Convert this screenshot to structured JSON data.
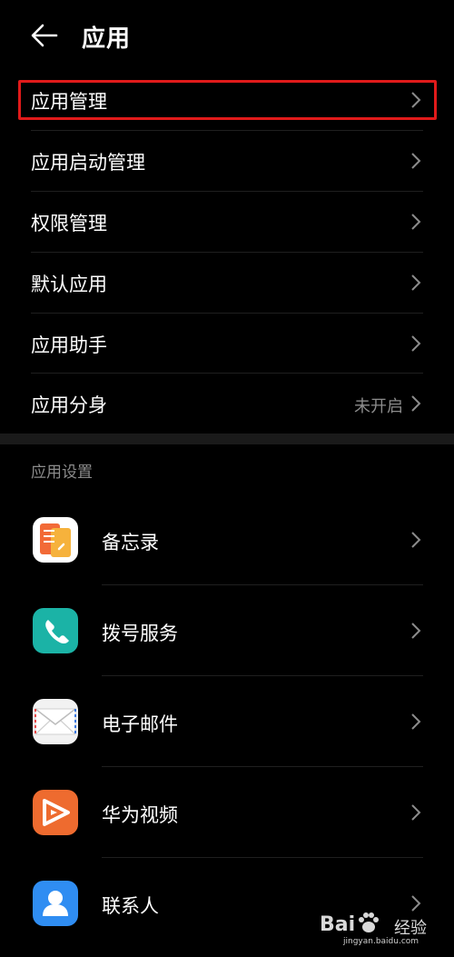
{
  "header": {
    "title": "应用"
  },
  "menu": [
    {
      "label": "应用管理",
      "value": ""
    },
    {
      "label": "应用启动管理",
      "value": ""
    },
    {
      "label": "权限管理",
      "value": ""
    },
    {
      "label": "默认应用",
      "value": ""
    },
    {
      "label": "应用助手",
      "value": ""
    },
    {
      "label": "应用分身",
      "value": "未开启"
    }
  ],
  "section": {
    "title": "应用设置"
  },
  "apps": [
    {
      "label": "备忘录",
      "icon": "notepad-icon",
      "color": "#f0673a"
    },
    {
      "label": "拨号服务",
      "icon": "phone-icon",
      "color": "#1bb3a6"
    },
    {
      "label": "电子邮件",
      "icon": "email-icon",
      "color": "#e9e9e9"
    },
    {
      "label": "华为视频",
      "icon": "video-icon",
      "color": "#ee6b2f"
    },
    {
      "label": "联系人",
      "icon": "contacts-icon",
      "color": "#2f8df2"
    }
  ],
  "watermark": {
    "brand": "Bai",
    "suffix": "经验",
    "url": "jingyan.baidu.com"
  },
  "colors": {
    "highlight": "#e01a1a",
    "background": "#000000",
    "secondary_text": "#8c8c8c"
  }
}
